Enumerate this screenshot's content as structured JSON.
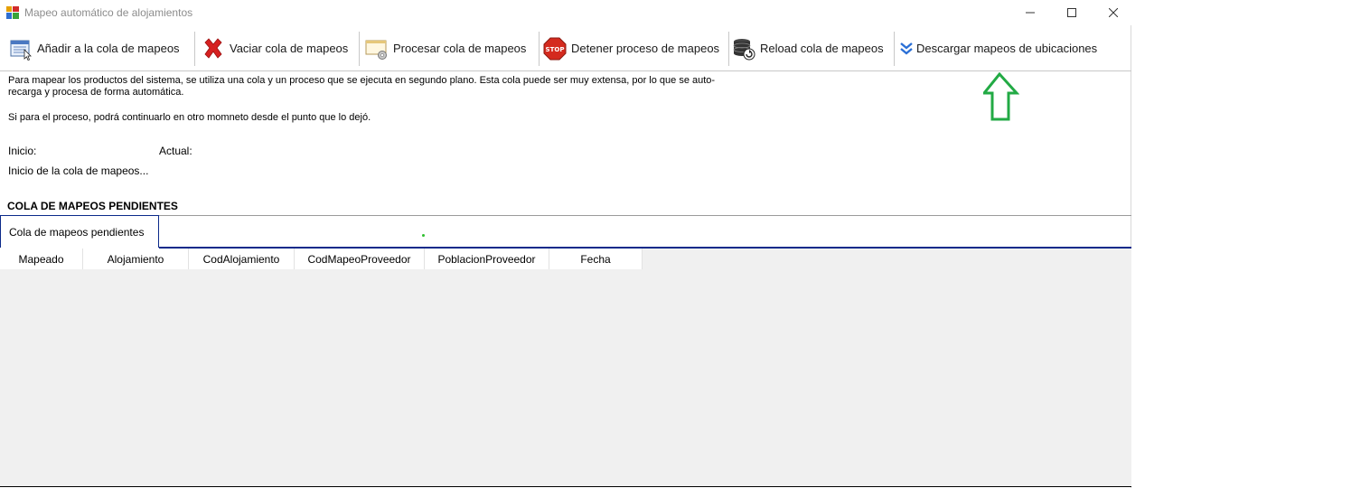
{
  "window": {
    "title": "Mapeo automático de alojamientos"
  },
  "toolbar": {
    "buttons": [
      {
        "label": "Añadir a la cola de mapeos",
        "icon": "add-to-queue-icon"
      },
      {
        "label": "Vaciar cola de mapeos",
        "icon": "red-x-icon"
      },
      {
        "label": "Procesar cola de mapeos",
        "icon": "process-gear-icon"
      },
      {
        "label": "Detener proceso de mapeos",
        "icon": "stop-sign-icon"
      },
      {
        "label": "Reload cola de mapeos",
        "icon": "database-reload-icon"
      },
      {
        "label": "Descargar mapeos de ubicaciones",
        "icon": "double-chevron-down-icon"
      }
    ]
  },
  "description": {
    "line1": "Para mapear los productos del sistema, se utiliza una cola y un proceso que se ejecuta en segundo plano. Esta cola puede ser muy extensa, por lo que se auto-",
    "line2": "recarga y procesa de forma automática.",
    "line3": "Si para el proceso, podrá continuarlo en otro momneto desde el punto que lo dejó."
  },
  "status": {
    "inicio_label": "Inicio:",
    "actual_label": "Actual:",
    "message": "Inicio de la cola de mapeos..."
  },
  "queue": {
    "section_title": "COLA DE MAPEOS PENDIENTES",
    "tab_label": "Cola de mapeos pendientes",
    "columns": [
      "Mapeado",
      "Alojamiento",
      "CodAlojamiento",
      "CodMapeoProveedor",
      "PoblacionProveedor",
      "Fecha"
    ]
  },
  "colors": {
    "tab_border": "#0b2a8a",
    "annotation_arrow": "#22aa44",
    "grid_background": "#f0f0f0"
  }
}
